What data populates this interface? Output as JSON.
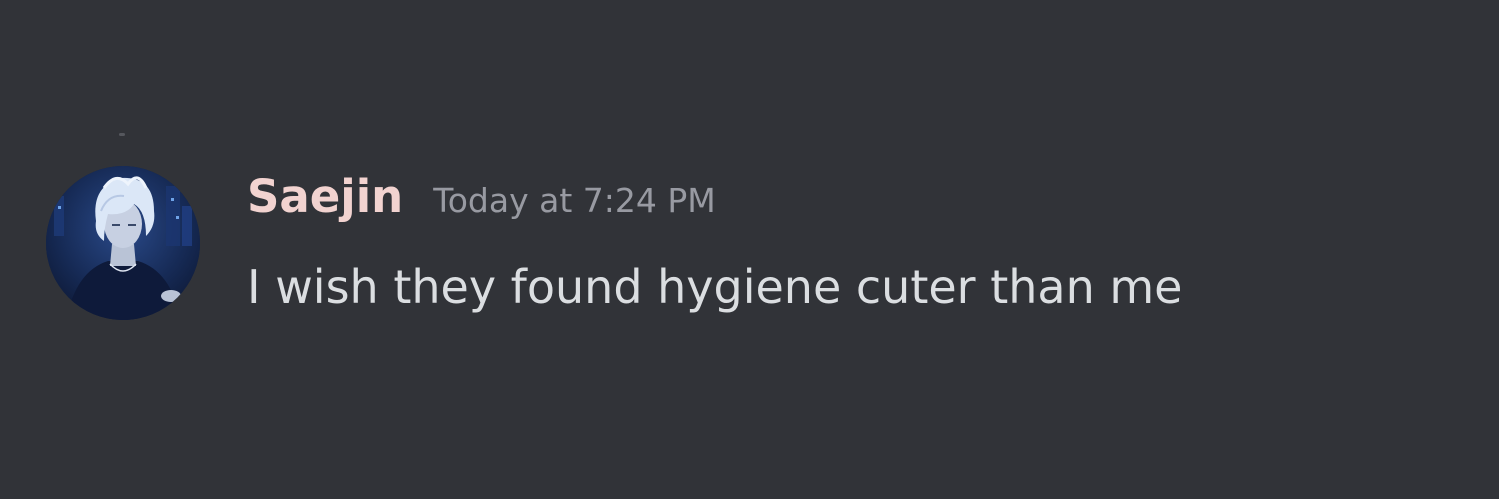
{
  "message": {
    "author": "Saejin",
    "timestamp": "Today at 7:24 PM",
    "content": "I wish they found hygiene cuter than me",
    "avatar_icon": "user-avatar-image"
  },
  "colors": {
    "background": "#313338",
    "username": "#f2d3d0",
    "timestamp": "#989aa2",
    "content": "#dbdee1"
  }
}
